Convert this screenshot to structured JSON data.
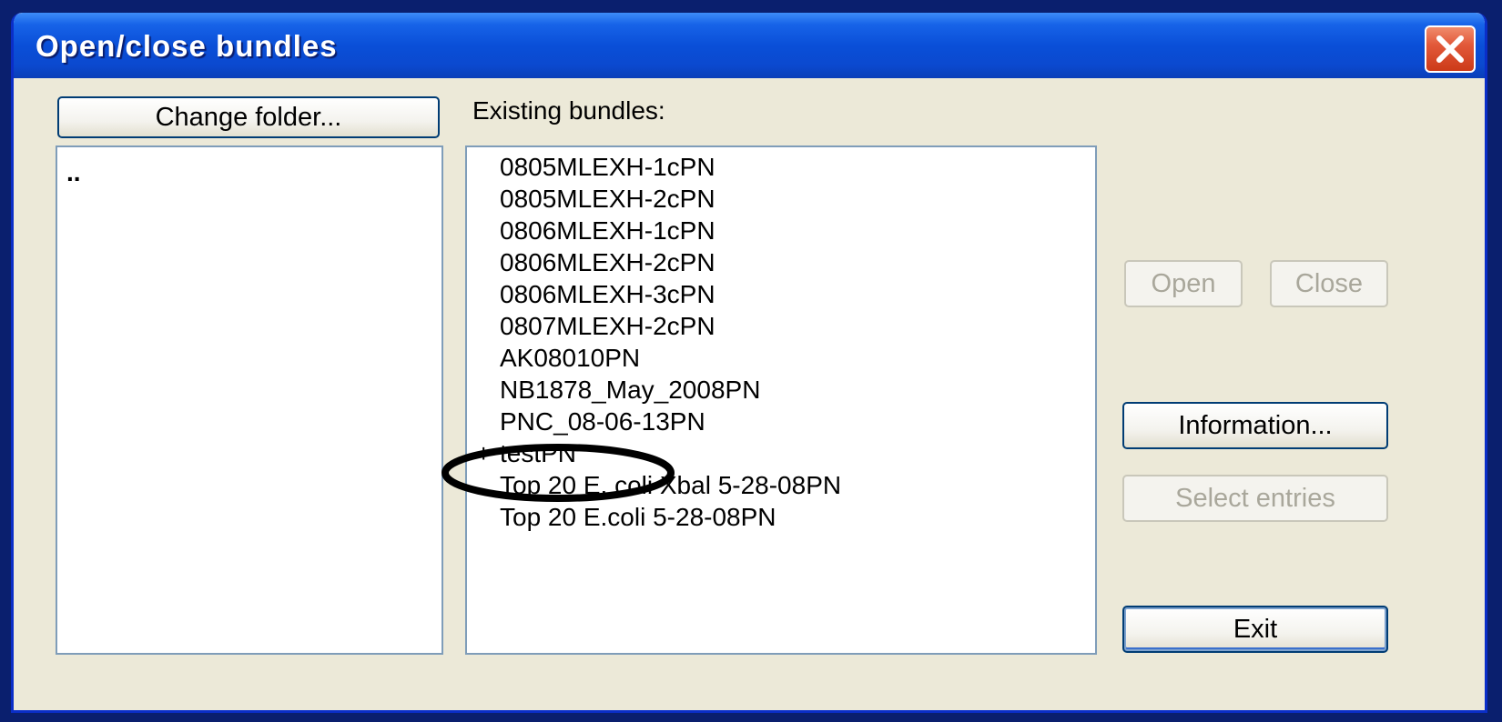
{
  "window": {
    "title": "Open/close bundles"
  },
  "left_panel": {
    "change_folder_label": "Change folder...",
    "folders": [
      ".."
    ]
  },
  "bundles": {
    "label": "Existing bundles:",
    "items": [
      {
        "marker": "",
        "name": "0805MLEXH-1cPN"
      },
      {
        "marker": "",
        "name": "0805MLEXH-2cPN"
      },
      {
        "marker": "",
        "name": "0806MLEXH-1cPN"
      },
      {
        "marker": "",
        "name": "0806MLEXH-2cPN"
      },
      {
        "marker": "",
        "name": "0806MLEXH-3cPN"
      },
      {
        "marker": "",
        "name": "0807MLEXH-2cPN"
      },
      {
        "marker": "",
        "name": "AK08010PN"
      },
      {
        "marker": "",
        "name": "NB1878_May_2008PN"
      },
      {
        "marker": "",
        "name": "PNC_08-06-13PN"
      },
      {
        "marker": "+",
        "name": "testPN"
      },
      {
        "marker": "",
        "name": "Top 20 E. coli Xbal 5-28-08PN"
      },
      {
        "marker": "",
        "name": "Top 20 E.coli 5-28-08PN"
      }
    ]
  },
  "actions": {
    "open_label": "Open",
    "close_label": "Close",
    "information_label": "Information...",
    "select_entries_label": "Select entries",
    "exit_label": "Exit"
  },
  "icons": {
    "close_window": "close-x-icon"
  },
  "colors": {
    "titlebar": "#0a4fd8",
    "dialog_bg": "#ece9d8",
    "close_button": "#e2593a",
    "annotation": "#000000"
  }
}
